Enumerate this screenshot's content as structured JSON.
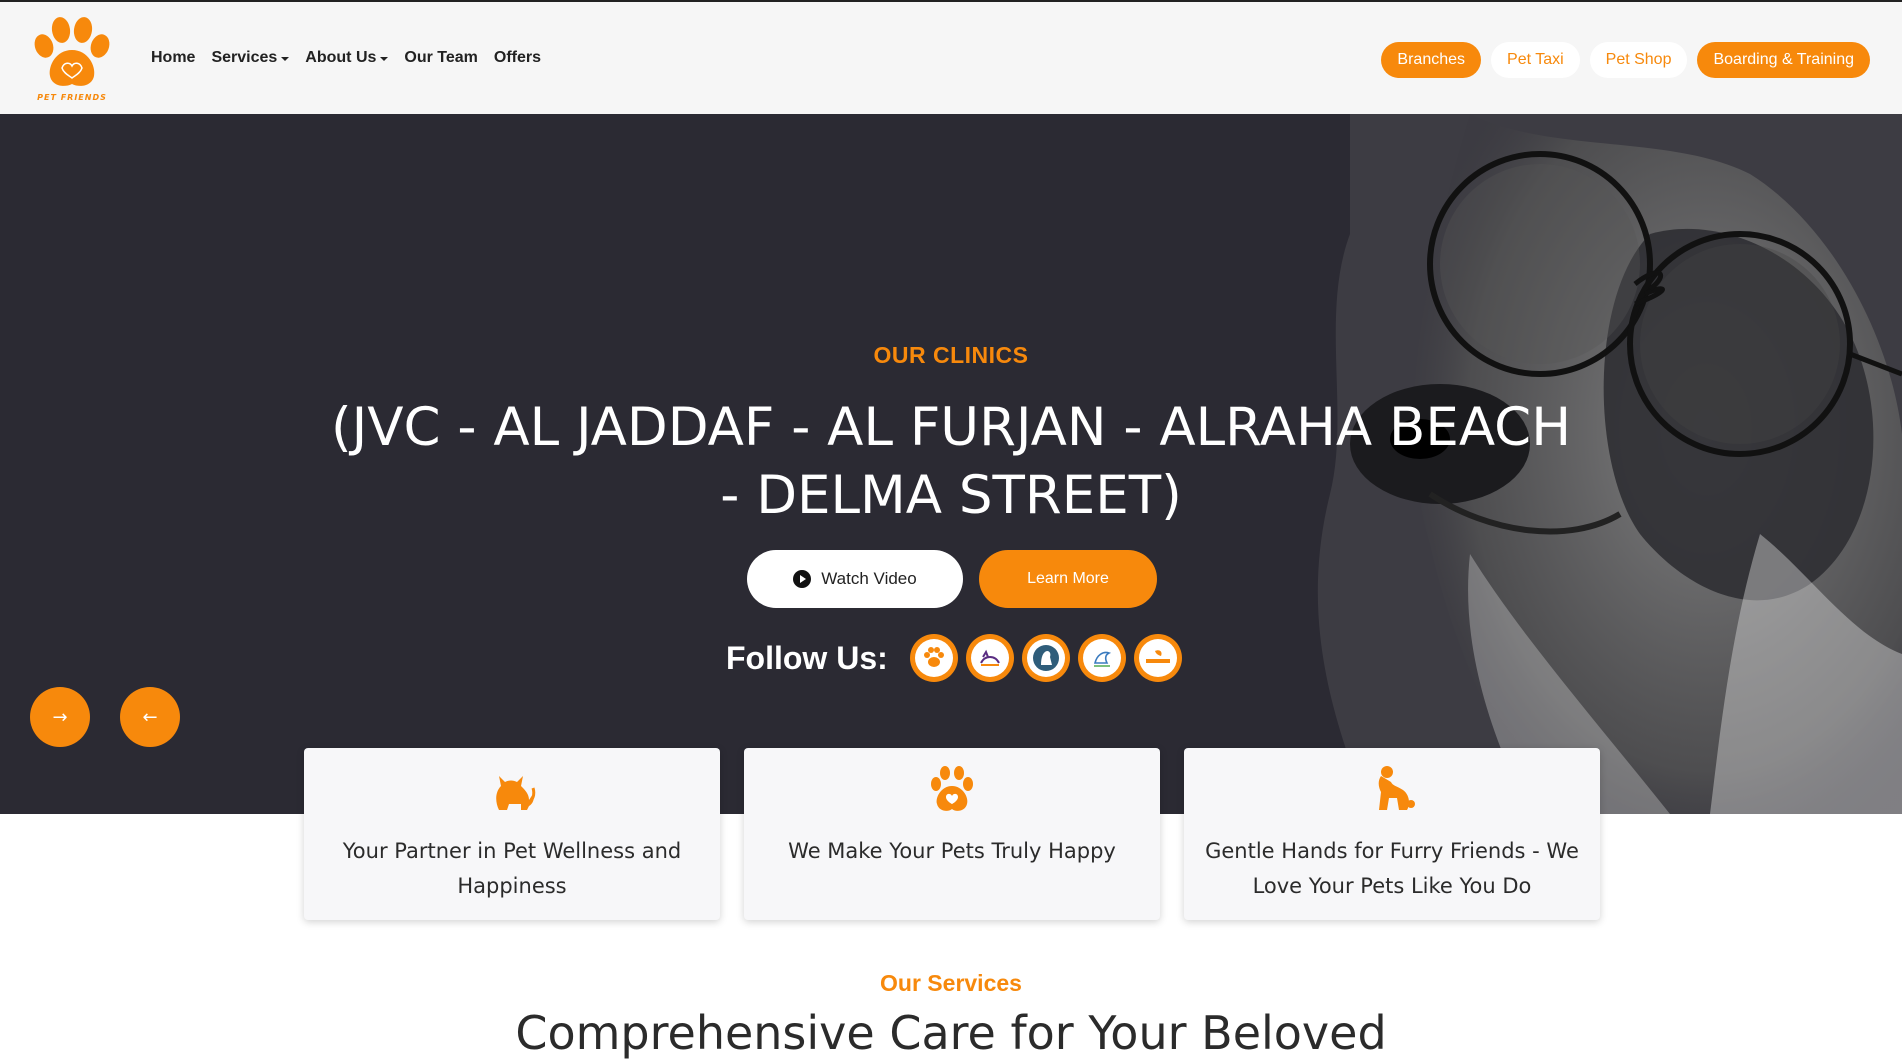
{
  "brand": {
    "logo_text": "PET FRIENDS",
    "accent_color": "#f7890c",
    "hero_bg_color": "#2b2a33"
  },
  "nav": {
    "links": [
      {
        "label": "Home",
        "dropdown": false
      },
      {
        "label": "Services",
        "dropdown": true
      },
      {
        "label": "About Us",
        "dropdown": true
      },
      {
        "label": "Our Team",
        "dropdown": false
      },
      {
        "label": "Offers",
        "dropdown": false
      }
    ],
    "pills": [
      {
        "label": "Branches",
        "style": "filled"
      },
      {
        "label": "Pet Taxi",
        "style": "outline"
      },
      {
        "label": "Pet Shop",
        "style": "outline"
      },
      {
        "label": "Boarding & Training",
        "style": "filled"
      }
    ]
  },
  "hero": {
    "kicker": "OUR CLINICS",
    "title": "(JVC - AL JADDAF - AL FURJAN - ALRAHA BEACH - DELMA STREET)",
    "watch_video_label": "Watch Video",
    "learn_more_label": "Learn More",
    "follow_label": "Follow Us:",
    "social_icons": [
      "pet-friends-paw-icon",
      "cat-logo-icon",
      "dog-logo-icon",
      "bird-logo-icon",
      "liberty-logo-icon"
    ],
    "next_arrow": "→",
    "prev_arrow": "←"
  },
  "features": [
    {
      "icon": "cat-icon",
      "text": "Your Partner in Pet Wellness and Happiness"
    },
    {
      "icon": "paw-heart-icon",
      "text": "We Make Your Pets Truly Happy"
    },
    {
      "icon": "dog-icon",
      "text": "Gentle Hands for Furry Friends - We Love Your Pets Like You Do"
    }
  ],
  "services": {
    "kicker": "Our Services",
    "heading": "Comprehensive Care for Your Beloved"
  }
}
